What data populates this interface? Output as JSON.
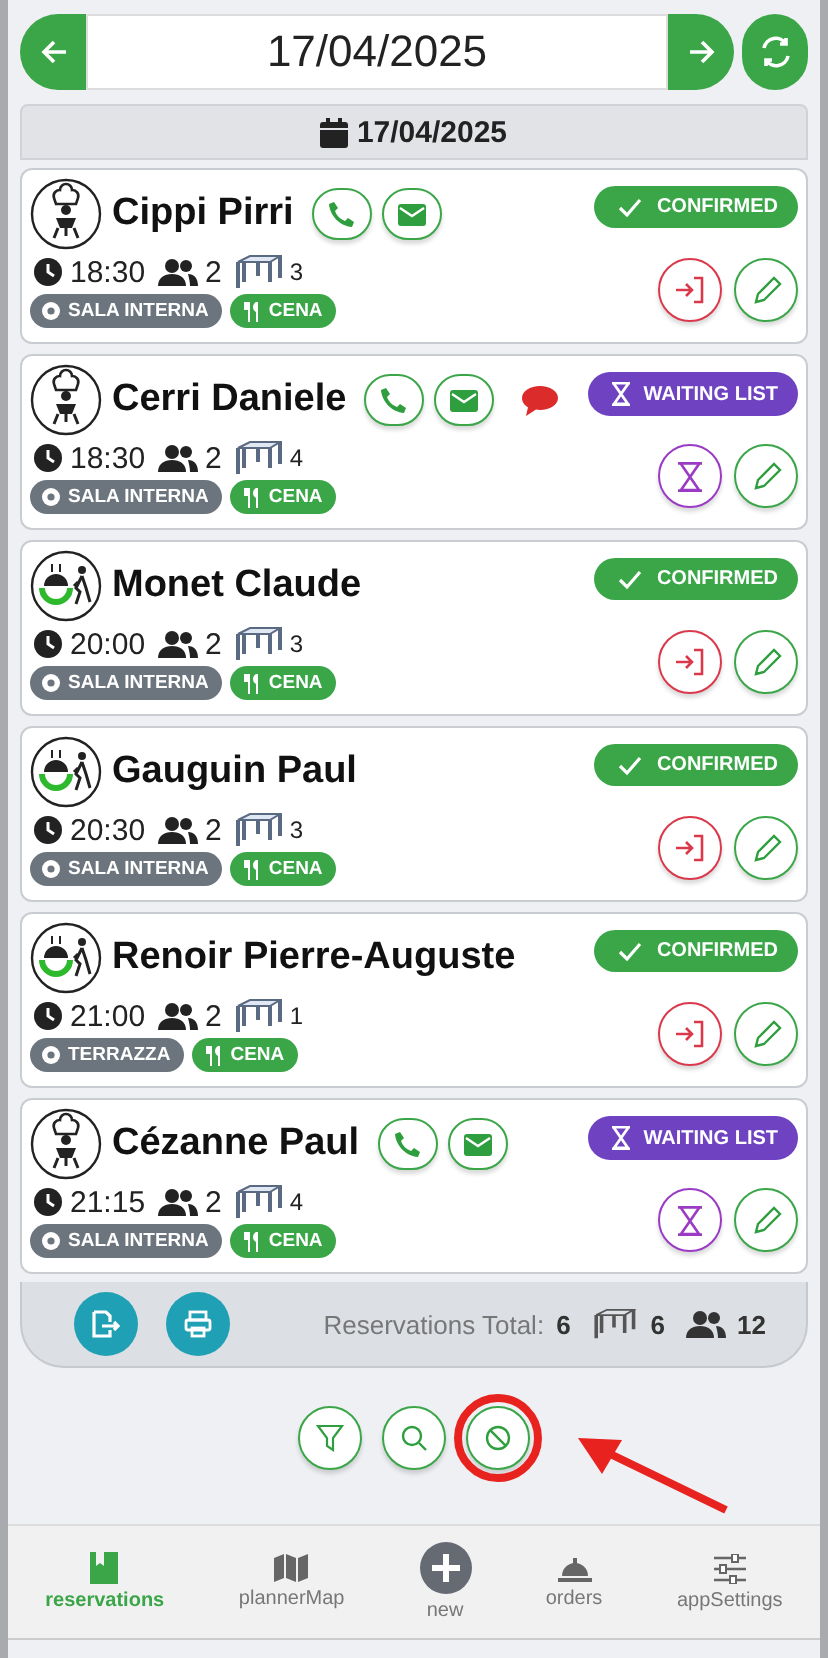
{
  "date_nav": {
    "value": "17/04/2025"
  },
  "date_header": "17/04/2025",
  "reservations": [
    {
      "name": "Cippi Pirri",
      "avatar": {
        "kind": "chef"
      },
      "phone": true,
      "email": true,
      "note": false,
      "status": {
        "kind": "confirmed",
        "label": "CONFIRMED"
      },
      "time": "18:30",
      "guests": "2",
      "table": "3",
      "room": "SALA INTERNA",
      "meal": "CENA"
    },
    {
      "name": "Cerri Daniele",
      "avatar": {
        "kind": "chef"
      },
      "phone": true,
      "email": true,
      "note": true,
      "status": {
        "kind": "waiting",
        "label": "WAITING LIST"
      },
      "time": "18:30",
      "guests": "2",
      "table": "4",
      "room": "SALA INTERNA",
      "meal": "CENA"
    },
    {
      "name": "Monet Claude",
      "avatar": {
        "kind": "walkin"
      },
      "phone": false,
      "email": false,
      "note": false,
      "status": {
        "kind": "confirmed",
        "label": "CONFIRMED"
      },
      "time": "20:00",
      "guests": "2",
      "table": "3",
      "room": "SALA INTERNA",
      "meal": "CENA"
    },
    {
      "name": "Gauguin Paul",
      "avatar": {
        "kind": "walkin"
      },
      "phone": false,
      "email": false,
      "note": false,
      "status": {
        "kind": "confirmed",
        "label": "CONFIRMED"
      },
      "time": "20:30",
      "guests": "2",
      "table": "3",
      "room": "SALA INTERNA",
      "meal": "CENA"
    },
    {
      "name": "Renoir Pierre-Auguste",
      "avatar": {
        "kind": "walkin"
      },
      "phone": false,
      "email": false,
      "note": false,
      "status": {
        "kind": "confirmed",
        "label": "CONFIRMED"
      },
      "time": "21:00",
      "guests": "2",
      "table": "1",
      "room": "TERRAZZA",
      "meal": "CENA"
    },
    {
      "name": "Cézanne Paul",
      "avatar": {
        "kind": "chef"
      },
      "phone": true,
      "email": true,
      "note": false,
      "status": {
        "kind": "waiting",
        "label": "WAITING LIST"
      },
      "time": "21:15",
      "guests": "2",
      "table": "4",
      "room": "SALA INTERNA",
      "meal": "CENA"
    }
  ],
  "summary": {
    "label": "Reservations Total:",
    "total": "6",
    "tables": "6",
    "guests": "12"
  },
  "nav": [
    {
      "label": "reservations",
      "selected": true
    },
    {
      "label": "plannerMap",
      "selected": false
    },
    {
      "label": "new",
      "selected": false
    },
    {
      "label": "orders",
      "selected": false
    },
    {
      "label": "appSettings",
      "selected": false
    }
  ]
}
